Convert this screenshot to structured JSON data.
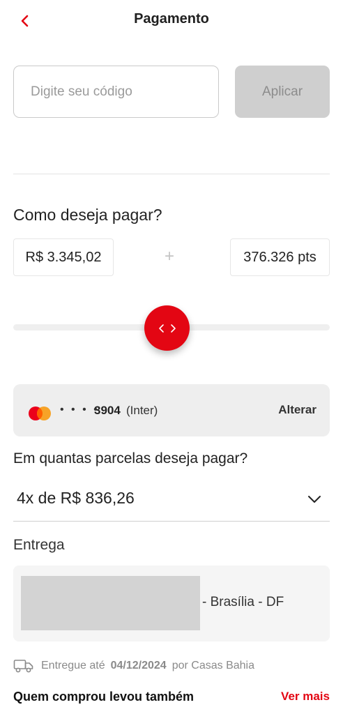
{
  "header": {
    "title": "Pagamento"
  },
  "coupon": {
    "placeholder": "Digite seu código",
    "value": "",
    "apply_label": "Aplicar"
  },
  "payment": {
    "question": "Como deseja pagar?",
    "money_amount": "R$ 3.345,02",
    "plus": "+",
    "points_amount": "376.326 pts",
    "split_fraction_cash": 0.5
  },
  "card": {
    "masked": "• • • •",
    "last_digits": "3904",
    "bank": "(Inter)",
    "change_label": "Alterar",
    "brand_colors": [
      "#eb001b",
      "#f79e1b"
    ]
  },
  "installments": {
    "question": "Em quantas parcelas deseja pagar?",
    "selected": "4x de R$ 836,26"
  },
  "delivery": {
    "title": "Entrega",
    "city": "- Brasília - DF",
    "prefix": "Entregue até",
    "date": "04/12/2024",
    "suffix": "por Casas Bahia"
  },
  "recommendations": {
    "title": "Quem comprou levou também",
    "see_more": "Ver mais"
  },
  "colors": {
    "accent": "#e30613",
    "disabled_button": "#cfcfcf"
  }
}
